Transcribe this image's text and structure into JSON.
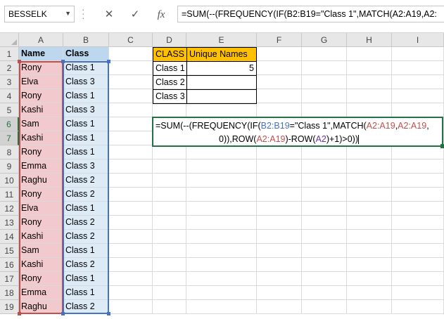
{
  "name_box": {
    "value": "BESSELK"
  },
  "formula_bar": {
    "cancel_icon": "✕",
    "enter_icon": "✓",
    "function_icon": "fx",
    "text": "=SUM(--(FREQUENCY(IF(B2:B19=\"Class 1\",MATCH(A2:A19,A2:"
  },
  "columns": [
    "A",
    "B",
    "C",
    "D",
    "E",
    "F",
    "G",
    "H",
    "I"
  ],
  "rows": [
    "1",
    "2",
    "3",
    "4",
    "5",
    "6",
    "7",
    "8",
    "9",
    "10",
    "11",
    "12",
    "13",
    "14",
    "15",
    "16",
    "17",
    "18",
    "19"
  ],
  "table": {
    "header": {
      "name": "Name",
      "class": "Class"
    },
    "data": [
      {
        "name": "Rony",
        "class": "Class 1"
      },
      {
        "name": "Elva",
        "class": "Class 3"
      },
      {
        "name": "Rony",
        "class": "Class 1"
      },
      {
        "name": "Kashi",
        "class": "Class 3"
      },
      {
        "name": "Sam",
        "class": "Class 1"
      },
      {
        "name": "Kashi",
        "class": "Class 1"
      },
      {
        "name": "Rony",
        "class": "Class 1"
      },
      {
        "name": "Emma",
        "class": "Class 3"
      },
      {
        "name": "Raghu",
        "class": "Class 2"
      },
      {
        "name": "Rony",
        "class": "Class 2"
      },
      {
        "name": "Elva",
        "class": "Class 1"
      },
      {
        "name": "Rony",
        "class": "Class 2"
      },
      {
        "name": "Kashi",
        "class": "Class 2"
      },
      {
        "name": "Sam",
        "class": "Class 1"
      },
      {
        "name": "Kashi",
        "class": "Class 2"
      },
      {
        "name": "Rony",
        "class": "Class 1"
      },
      {
        "name": "Emma",
        "class": "Class 1"
      },
      {
        "name": "Raghu",
        "class": "Class 2"
      }
    ]
  },
  "summary": {
    "header": {
      "class": "CLASS",
      "unique": "Unique Names"
    },
    "rows": [
      {
        "class": "Class 1",
        "unique": "5"
      },
      {
        "class": "Class 2",
        "unique": ""
      },
      {
        "class": "Class 3",
        "unique": ""
      }
    ]
  },
  "editor": {
    "line1": {
      "p1": "=SUM(--(FREQUENCY(IF(",
      "r1": "B2:B19",
      "p2": "=\"Class 1\",MATCH(",
      "r2": "A2:A19",
      "p3": ",",
      "r3": "A2:A19",
      "p4": ","
    },
    "line2": {
      "p1": "0)),ROW(",
      "r1": "A2:A19",
      "p2": ")-ROW(",
      "r2": "A2",
      "p3": ")+1)>0))"
    }
  },
  "colors": {
    "excel_green": "#217346",
    "header_blue": "#bdd7ee",
    "name_pink": "#f2c9cc",
    "class_blue": "#ddebf7",
    "summary_orange": "#ffc000"
  }
}
